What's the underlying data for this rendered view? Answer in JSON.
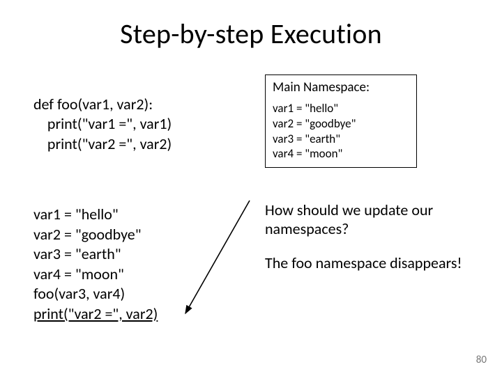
{
  "title": "Step-by-step Execution",
  "code1": {
    "l1": "def foo(var1, var2):",
    "l2": "    print(\"var1 =\", var1)",
    "l3": "    print(\"var2 =\", var2)"
  },
  "code2": {
    "l1": "var1 = \"hello\"",
    "l2": "var2 = \"goodbye\"",
    "l3": "var3 = \"earth\"",
    "l4": "var4 = \"moon\"",
    "l5": "foo(var3, var4)",
    "l6": "print(\"var2 =\", var2)"
  },
  "ns": {
    "title": "Main Namespace:",
    "l1": "var1 = \"hello\"",
    "l2": "var2 = \"goodbye\"",
    "l3": "var3 = \"earth\"",
    "l4": "var4 = \"moon\""
  },
  "right": {
    "q_line1": "How should we update our",
    "q_line2": "namespaces?",
    "a": "The foo namespace disappears!"
  },
  "pagenum": "80"
}
